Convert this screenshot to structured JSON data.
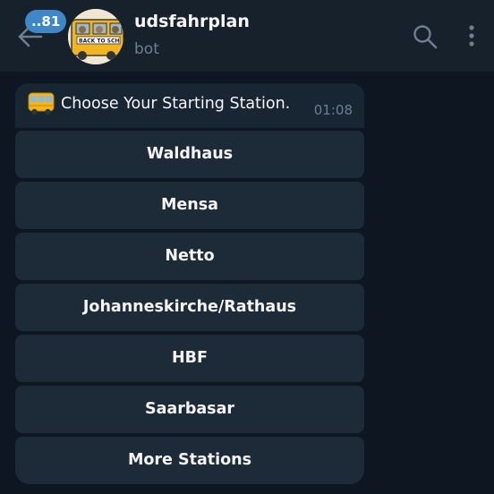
{
  "header": {
    "unread_count": "..81",
    "title": "udsfahrplan",
    "subtitle": "bot",
    "avatar_text": "BACK TO SCH"
  },
  "message": {
    "icon": "bus-emoji",
    "text": "Choose Your Starting Station.",
    "time": "01:08"
  },
  "keyboard": {
    "buttons": [
      "Waldhaus",
      "Mensa",
      "Netto",
      "Johanneskirche/Rathaus",
      "HBF",
      "Saarbasar",
      "More Stations"
    ]
  },
  "colors": {
    "background": "#0e1621",
    "header": "#17212b",
    "badge": "#3e87c8",
    "bubble": "#182533",
    "button": "#1d2a38",
    "muted_text": "#6d7f8f"
  }
}
